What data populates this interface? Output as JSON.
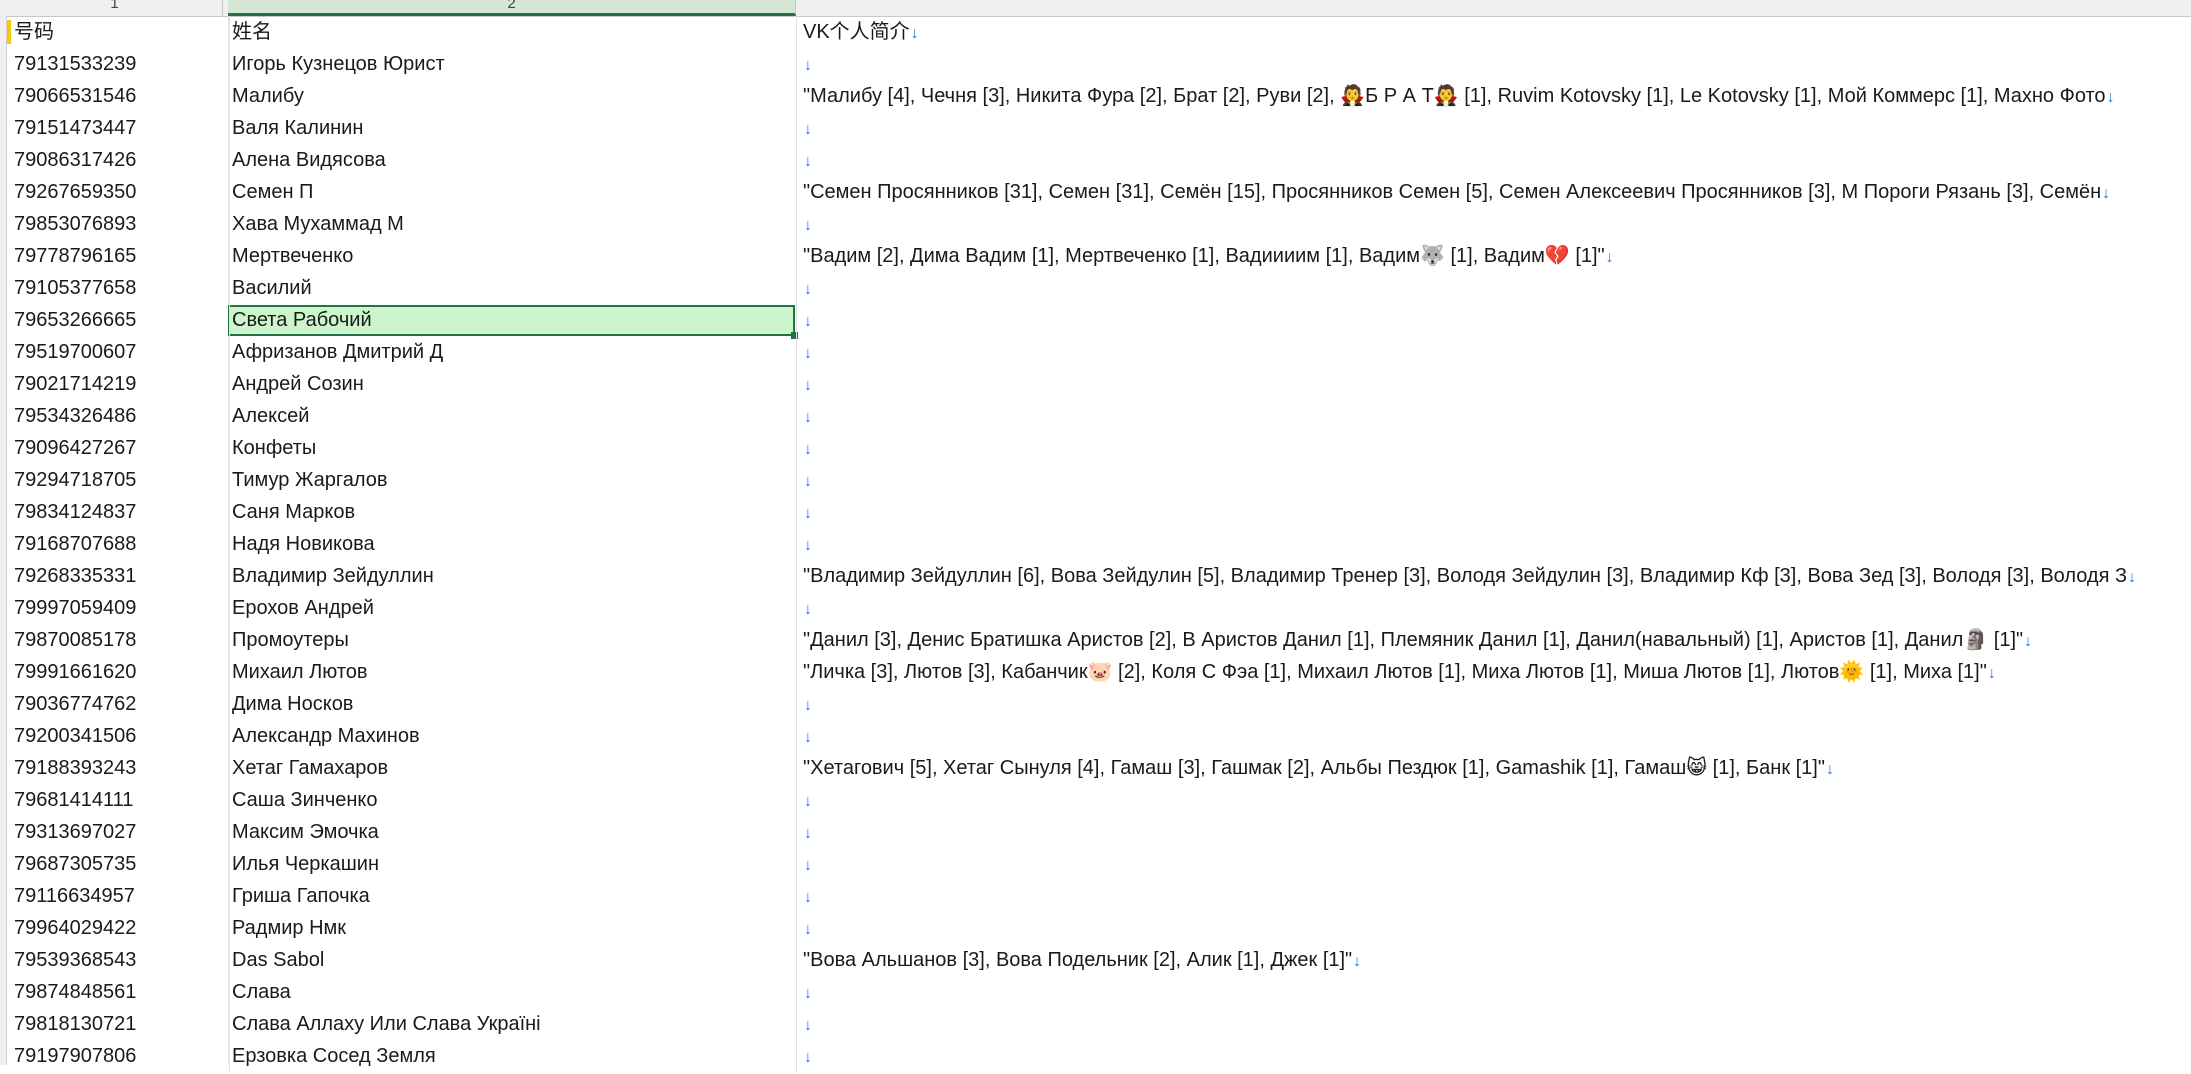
{
  "column_headers": [
    "1",
    "2"
  ],
  "header_row": {
    "col1": "号码",
    "col2": "姓名",
    "col3": "VK个人简介"
  },
  "rows": [
    {
      "phone": "79131533239",
      "name": "Игорь Кузнецов Юрист",
      "bio": ""
    },
    {
      "phone": "79066531546",
      "name": "Малибу",
      "bio": "\"Малибу [4], Чечня [3], Никита Фура [2], Брат [2], Руви [2], 🧛Б Р А Т🧛 [1], Ruvim Kotovsky [1], Le Kotovsky [1], Мой Коммерс [1], Махно Фото"
    },
    {
      "phone": "79151473447",
      "name": "Валя Калинин",
      "bio": ""
    },
    {
      "phone": "79086317426",
      "name": "Алена Видясова",
      "bio": ""
    },
    {
      "phone": "79267659350",
      "name": "Семен П",
      "bio": "\"Семен Просянников [31], Семен [31], Семён [15], Просянников Семен [5], Семен Алексеевич Просянников [3], М Пороги Рязань [3], Семён"
    },
    {
      "phone": "79853076893",
      "name": "Хава Мухаммад М",
      "bio": ""
    },
    {
      "phone": "79778796165",
      "name": "Мертвеченко",
      "bio": "\"Вадим [2], Дима Вадим [1], Мертвеченко [1], Вадиииим [1], Вадим🐺 [1], Вадим💔 [1]\""
    },
    {
      "phone": "79105377658",
      "name": "Василий",
      "bio": ""
    },
    {
      "phone": "79653266665",
      "name": "Света Рабочий",
      "bio": ""
    },
    {
      "phone": "79519700607",
      "name": "Афризанов Дмитрий Д",
      "bio": ""
    },
    {
      "phone": "79021714219",
      "name": "Андрей Созин",
      "bio": ""
    },
    {
      "phone": "79534326486",
      "name": "Алексей",
      "bio": ""
    },
    {
      "phone": "79096427267",
      "name": "Конфеты",
      "bio": ""
    },
    {
      "phone": "79294718705",
      "name": "Тимур Жаргалов",
      "bio": ""
    },
    {
      "phone": "79834124837",
      "name": "Саня Марков",
      "bio": ""
    },
    {
      "phone": "79168707688",
      "name": "Надя Новикова",
      "bio": ""
    },
    {
      "phone": "79268335331",
      "name": "Владимир Зейдуллин",
      "bio": "\"Владимир Зейдуллин [6], Вова Зейдулин [5], Владимир Тренер [3], Володя Зейдулин [3], Владимир Кф [3], Вова Зед [3], Володя [3], Володя З"
    },
    {
      "phone": "79997059409",
      "name": "Ерохов Андрей",
      "bio": ""
    },
    {
      "phone": "79870085178",
      "name": "Промоутеры",
      "bio": "\"Данил [3], Денис Братишка Аристов [2], В Аристов Данил [1], Племяник Данил [1], Данил(навальный) [1], Аристов [1], Данил🗿 [1]\""
    },
    {
      "phone": "79991661620",
      "name": "Михаил Лютов",
      "bio": "\"Личка [3], Лютов [3], Кабанчик🐷 [2], Коля С Фэа [1], Михаил Лютов [1], Миха Лютов [1], Миша Лютов [1], Лютов🌞 [1], Миха [1]\""
    },
    {
      "phone": "79036774762",
      "name": "Дима Носков",
      "bio": ""
    },
    {
      "phone": "79200341506",
      "name": "Александр Махинов",
      "bio": ""
    },
    {
      "phone": "79188393243",
      "name": "Хетаг Гамахаров",
      "bio": "\"Хетагович [5], Хетаг Сынуля [4], Гамаш [3], Гашмак [2], Альбы Пездюк [1], Gamashik [1], Гамаш😸 [1], Банк [1]\""
    },
    {
      "phone": "79681414111",
      "name": "Саша Зинченко",
      "bio": ""
    },
    {
      "phone": "79313697027",
      "name": "Максим Эмочка",
      "bio": ""
    },
    {
      "phone": "79687305735",
      "name": "Илья Черкашин",
      "bio": ""
    },
    {
      "phone": "79116634957",
      "name": "Гриша Гапочка",
      "bio": ""
    },
    {
      "phone": "79964029422",
      "name": "Радмир Нмк",
      "bio": ""
    },
    {
      "phone": "79539368543",
      "name": "Das Sabol",
      "bio": "\"Вова Альшанов [3], Вова Подельник [2], Алик [1], Джек [1]\""
    },
    {
      "phone": "79874848561",
      "name": "Слава",
      "bio": ""
    },
    {
      "phone": "79818130721",
      "name": "Слава Аллаху Или Слава Україні",
      "bio": ""
    },
    {
      "phone": "79197907806",
      "name": "Ерзовка Сосед Земля",
      "bio": ""
    }
  ],
  "line_break_glyph": "↓",
  "selected_row_index": 8,
  "colors": {
    "accent": "#217346",
    "selection_fill": "#ccf5cc",
    "arrow": "#2f7ad6"
  }
}
